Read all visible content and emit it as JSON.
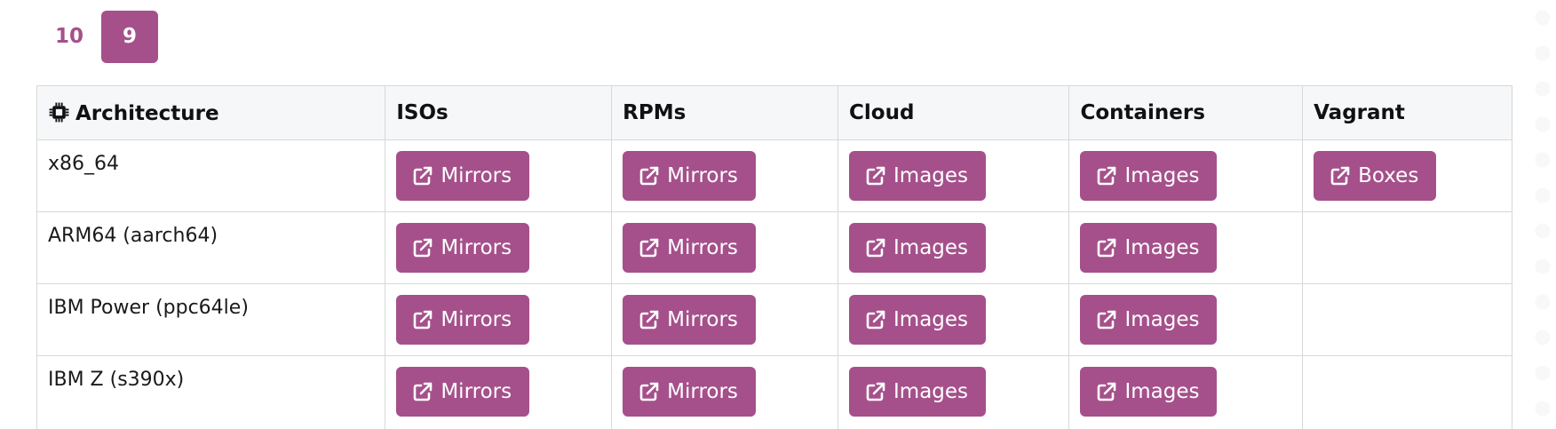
{
  "version_tabs": [
    {
      "label": "10",
      "active": false
    },
    {
      "label": "9",
      "active": true
    }
  ],
  "table": {
    "headers": {
      "architecture": "Architecture",
      "isos": "ISOs",
      "rpms": "RPMs",
      "cloud": "Cloud",
      "containers": "Containers",
      "vagrant": "Vagrant"
    },
    "rows": [
      {
        "arch": "x86_64",
        "isos": "Mirrors",
        "rpms": "Mirrors",
        "cloud": "Images",
        "containers": "Images",
        "vagrant": "Boxes"
      },
      {
        "arch": "ARM64 (aarch64)",
        "isos": "Mirrors",
        "rpms": "Mirrors",
        "cloud": "Images",
        "containers": "Images",
        "vagrant": ""
      },
      {
        "arch": "IBM Power (ppc64le)",
        "isos": "Mirrors",
        "rpms": "Mirrors",
        "cloud": "Images",
        "containers": "Images",
        "vagrant": ""
      },
      {
        "arch": "IBM Z (s390x)",
        "isos": "Mirrors",
        "rpms": "Mirrors",
        "cloud": "Images",
        "containers": "Images",
        "vagrant": ""
      }
    ]
  },
  "icons": {
    "header": "cpu-chip-icon",
    "button": "external-link-icon"
  },
  "colors": {
    "accent": "#a5508b",
    "header_bg": "#f6f7f9",
    "border": "#d8d8d8"
  }
}
